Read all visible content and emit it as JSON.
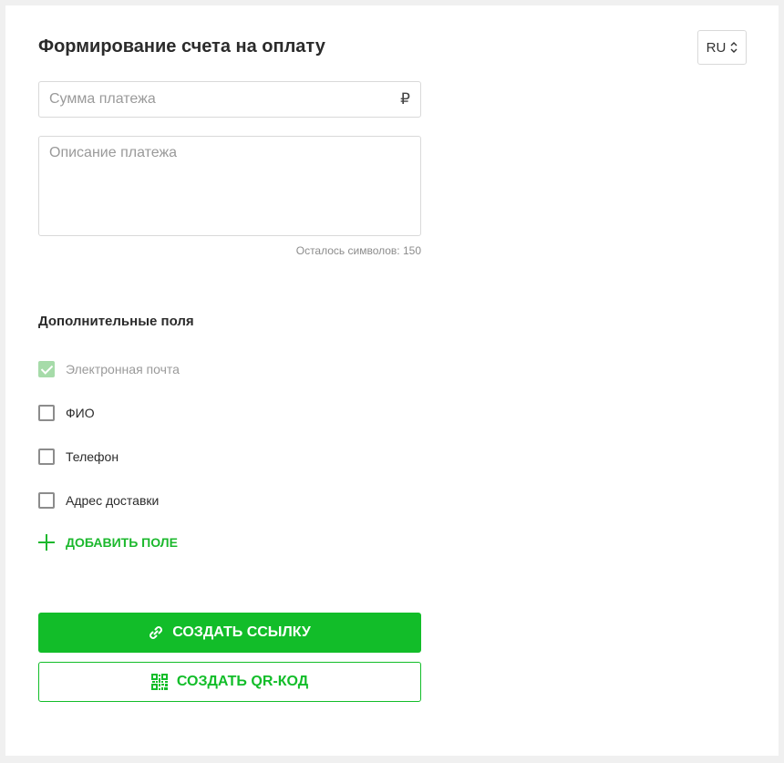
{
  "header": {
    "title": "Формирование счета на оплату",
    "language": "RU"
  },
  "form": {
    "amount_placeholder": "Сумма платежа",
    "currency_symbol": "₽",
    "description_placeholder": "Описание платежа",
    "chars_left_label": "Осталось символов:",
    "chars_left_value": "150"
  },
  "extra_fields": {
    "title": "Дополнительные поля",
    "items": [
      {
        "label": "Электронная почта",
        "checked": true,
        "disabled": true
      },
      {
        "label": "ФИО",
        "checked": false
      },
      {
        "label": "Телефон",
        "checked": false
      },
      {
        "label": "Адрес доставки",
        "checked": false
      }
    ],
    "add_label": "ДОБАВИТЬ ПОЛЕ"
  },
  "actions": {
    "create_link_label": "СОЗДАТЬ ССЫЛКУ",
    "create_qr_label": "СОЗДАТЬ QR-КОД"
  },
  "colors": {
    "accent": "#12bd29",
    "checkbox_disabled": "#a6dba9"
  },
  "icons": {
    "link": "link-icon",
    "qr": "qr-code-icon",
    "plus": "plus-icon",
    "select": "chevron-up-down-icon"
  }
}
